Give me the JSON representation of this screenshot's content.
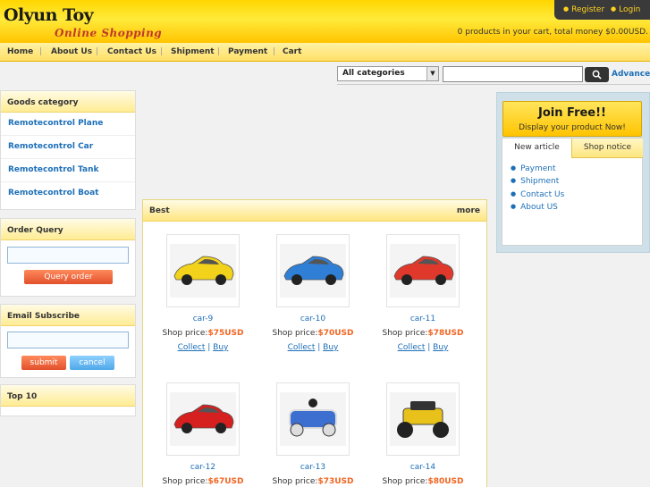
{
  "header": {
    "logo_title": "Olyun Toy",
    "logo_subtitle": "Online Shopping",
    "register": "Register",
    "login": "Login",
    "cart_info": "0 products in your cart, total money $0.00USD."
  },
  "nav": [
    "Home",
    "About Us",
    "Contact Us",
    "Shipment",
    "Payment",
    "Cart"
  ],
  "search": {
    "category_selected": "All categories",
    "advanced": "Advanced"
  },
  "goods_category": {
    "title": "Goods category",
    "items": [
      "Remotecontrol Plane",
      "Remotecontrol Car",
      "Remotecontrol Tank",
      "Remotecontrol Boat"
    ]
  },
  "order_query": {
    "title": "Order Query",
    "button": "Query order"
  },
  "email_subscribe": {
    "title": "Email Subscribe",
    "submit": "submit",
    "cancel": "cancel"
  },
  "top10": {
    "title": "Top 10"
  },
  "best": {
    "title": "Best",
    "more": "more",
    "price_label": "Shop price:",
    "collect": "Collect",
    "buy": "Buy",
    "products": [
      {
        "name": "car-9",
        "price": "$75USD",
        "color": "#f2d21a"
      },
      {
        "name": "car-10",
        "price": "$70USD",
        "color": "#2f7fd6"
      },
      {
        "name": "car-11",
        "price": "$78USD",
        "color": "#e0392b"
      },
      {
        "name": "car-12",
        "price": "$67USD",
        "color": "#d61f1f"
      },
      {
        "name": "car-13",
        "price": "$73USD",
        "color": "#3d6fd0"
      },
      {
        "name": "car-14",
        "price": "$80USD",
        "color": "#e8c21a"
      }
    ]
  },
  "right": {
    "join_title": "Join Free!!",
    "join_sub": "Display your product Now!",
    "tab_new": "New article",
    "tab_notice": "Shop notice",
    "links": [
      "Payment",
      "Shipment",
      "Contact Us",
      "About US"
    ]
  }
}
